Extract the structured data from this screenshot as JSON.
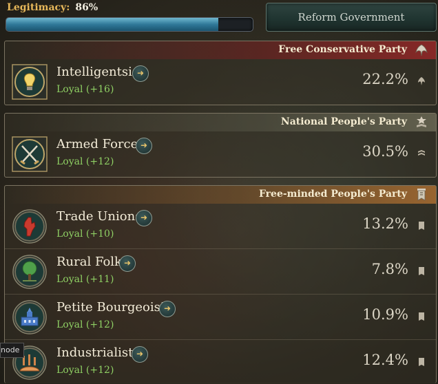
{
  "legitimacy": {
    "label": "Legitimacy:",
    "value": "86%",
    "fill": 0.86
  },
  "reform_button": "Reform Government",
  "parties": [
    {
      "name": "Free Conservative Party",
      "icon": "eagle-icon",
      "header_color": "#7a1f1f",
      "groups": [
        {
          "name": "Intelligentsia",
          "status": "Loyal",
          "change": "+16",
          "percent": "22.2%",
          "icon": "lightbulb-icon"
        }
      ]
    },
    {
      "name": "National People's Party",
      "icon": "stacked-chevrons-icon",
      "header_color": "#5a5a4a",
      "groups": [
        {
          "name": "Armed Forces",
          "status": "Loyal",
          "change": "+12",
          "percent": "30.5%",
          "icon": "crossed-swords-icon"
        }
      ]
    },
    {
      "name": "Free-minded People's Party",
      "icon": "banner-icon",
      "header_color": "#8a5a2a",
      "groups": [
        {
          "name": "Trade Unions",
          "status": "Loyal",
          "change": "+10",
          "percent": "13.2%",
          "icon": "fist-icon"
        },
        {
          "name": "Rural Folk",
          "status": "Loyal",
          "change": "+11",
          "percent": "7.8%",
          "icon": "tree-icon"
        },
        {
          "name": "Petite Bourgeoisie",
          "status": "Loyal",
          "change": "+12",
          "percent": "10.9%",
          "icon": "town-hall-icon"
        },
        {
          "name": "Industrialists",
          "status": "Loyal",
          "change": "+12",
          "percent": "12.4%",
          "icon": "factory-icon"
        }
      ]
    }
  ],
  "tooltip": "node"
}
